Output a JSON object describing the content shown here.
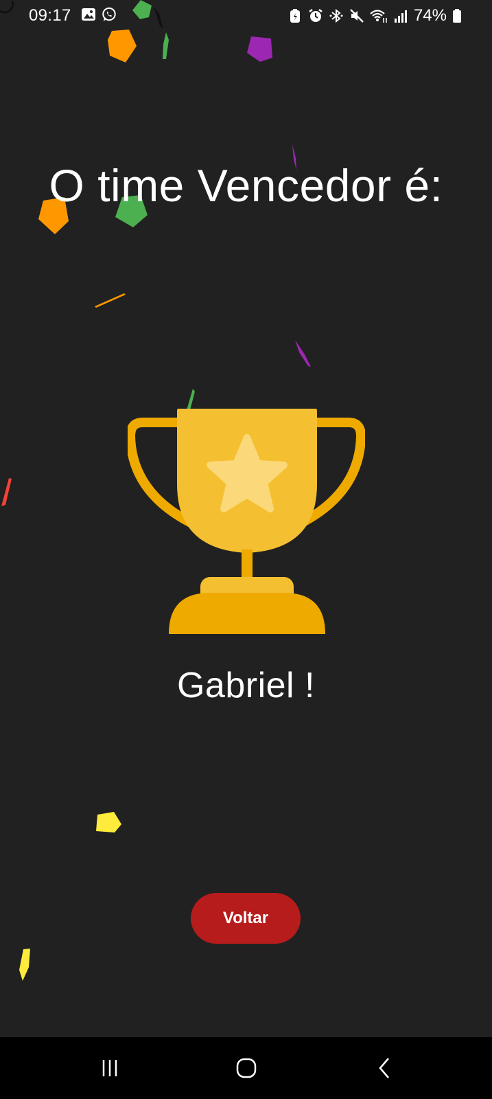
{
  "status_bar": {
    "time": "09:17",
    "battery_percent": "74%",
    "left_icons": [
      "gallery-icon",
      "whatsapp-icon"
    ],
    "right_icons": [
      "battery-saver-icon",
      "alarm-icon",
      "bluetooth-icon",
      "mute-icon",
      "wifi-icon",
      "signal-icon",
      "battery-icon"
    ]
  },
  "main": {
    "title": "O time Vencedor é:",
    "winner": "Gabriel !",
    "icon": "trophy-icon"
  },
  "actions": {
    "back_label": "Voltar"
  },
  "nav_bar": {
    "buttons": [
      "recent-apps-icon",
      "home-icon",
      "back-icon"
    ]
  },
  "colors": {
    "background": "#212121",
    "button": "#b71c1c",
    "trophy_gold": "#f4c031",
    "trophy_dark": "#efaa00",
    "star": "#fbd97a",
    "confetti": [
      "#ff9800",
      "#4caf50",
      "#9c27b0",
      "#f44336",
      "#ffeb3b"
    ]
  }
}
